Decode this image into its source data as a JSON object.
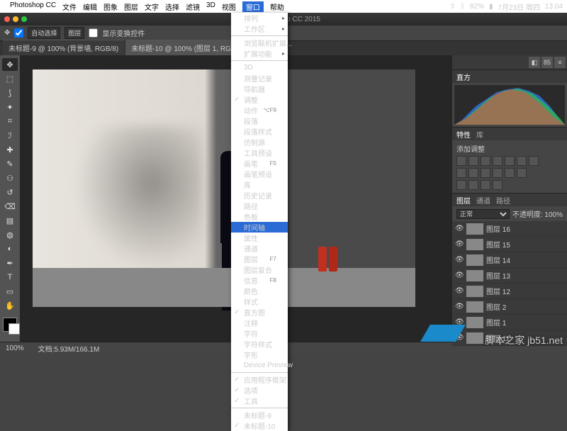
{
  "menubar": {
    "app": "Photoshop CC",
    "items": [
      "文件",
      "编辑",
      "图象",
      "图层",
      "文字",
      "选择",
      "滤镜",
      "3D",
      "视图",
      "窗口",
      "帮助"
    ],
    "selected_index": 9,
    "right": {
      "bt": "",
      "pct": "82%",
      "date": "7月23日 周四",
      "time": "13:04"
    }
  },
  "titlebar": {
    "title": "shop CC 2015"
  },
  "optbar": {
    "mode": "自动选择",
    "type": "图层",
    "opt": "显示变换控件"
  },
  "tabs": [
    {
      "label": "未标题-9 @ 100% (背景墙, RGB/8)",
      "active": false
    },
    {
      "label": "未标题-10 @ 100% (图层 1, RGB/8)",
      "active": true
    }
  ],
  "dropdown": {
    "items": [
      {
        "label": "排列",
        "sub": true
      },
      {
        "label": "工作区",
        "sub": true
      },
      {
        "sep": true
      },
      {
        "label": "浏览联机扩展..."
      },
      {
        "label": "扩展功能",
        "sub": true
      },
      {
        "sep": true
      },
      {
        "label": "3D"
      },
      {
        "label": "测量记录"
      },
      {
        "label": "导航器"
      },
      {
        "label": "调整",
        "chk": true
      },
      {
        "label": "动作",
        "sc": "⌥F9"
      },
      {
        "label": "段落"
      },
      {
        "label": "段落样式"
      },
      {
        "label": "仿制源"
      },
      {
        "label": "工具预设"
      },
      {
        "label": "画笔",
        "sc": "F5"
      },
      {
        "label": "画笔预设"
      },
      {
        "label": "库"
      },
      {
        "label": "历史记录"
      },
      {
        "label": "路径"
      },
      {
        "label": "色板"
      },
      {
        "label": "时间轴",
        "hl": true
      },
      {
        "label": "属性"
      },
      {
        "label": "通道"
      },
      {
        "label": "图层",
        "sc": "F7"
      },
      {
        "label": "图层复合"
      },
      {
        "label": "信息",
        "sc": "F8"
      },
      {
        "label": "颜色"
      },
      {
        "label": "样式"
      },
      {
        "label": "直方图",
        "chk": true
      },
      {
        "label": "注释"
      },
      {
        "label": "字符"
      },
      {
        "label": "字符样式"
      },
      {
        "label": "字形"
      },
      {
        "label": "Device Preview"
      },
      {
        "sep": true
      },
      {
        "label": "应用程序框架",
        "chk": true
      },
      {
        "label": "选项",
        "chk": true
      },
      {
        "label": "工具",
        "chk": true
      },
      {
        "sep": true
      },
      {
        "label": "未标题-9"
      },
      {
        "label": "未标题-10",
        "chk": true
      }
    ]
  },
  "panels": {
    "histogram": {
      "tabs": [
        "直方"
      ]
    },
    "adjust": {
      "tabs": [
        "特性",
        "库"
      ],
      "label": "添加调整"
    },
    "layers": {
      "tabs": [
        "图层",
        "通道",
        "路径"
      ],
      "mode": "正常",
      "opacity": "不透明度: 100%",
      "items": [
        {
          "name": "图层 16"
        },
        {
          "name": "图层 15"
        },
        {
          "name": "图层 14"
        },
        {
          "name": "图层 13"
        },
        {
          "name": "图层 12"
        },
        {
          "name": "图层 2"
        },
        {
          "name": "图层 1"
        },
        {
          "name": "图层 11"
        }
      ]
    }
  },
  "status": {
    "zoom": "100%",
    "info": "文档:5.93M/166.1M"
  },
  "watermark": "脚本之家 jb51.net"
}
